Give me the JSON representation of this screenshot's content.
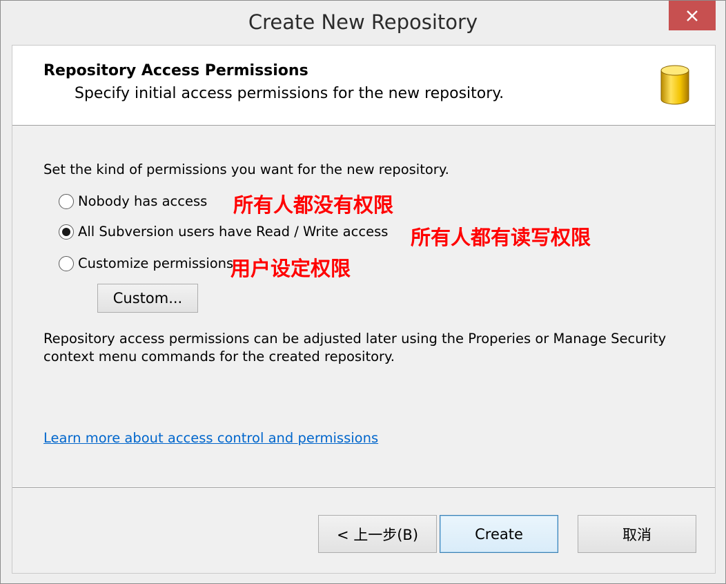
{
  "window": {
    "title": "Create New Repository",
    "close_glyph": "✕"
  },
  "header": {
    "title": "Repository Access Permissions",
    "subtitle": "Specify initial access permissions for the new repository.",
    "icon": "database-icon"
  },
  "body": {
    "intro": "Set the kind of permissions you want for the new repository.",
    "options": [
      {
        "label": "Nobody has access",
        "selected": false,
        "annotation": "所有人都没有权限"
      },
      {
        "label": "All Subversion users have Read / Write access",
        "selected": true,
        "annotation": "所有人都有读写权限"
      },
      {
        "label": "Customize permissions",
        "selected": false,
        "annotation": "用户设定权限"
      }
    ],
    "custom_button": "Custom...",
    "note_line1": "Repository access permissions can be adjusted later using the Properies or Manage Security",
    "note_line2": "context menu commands for the created repository.",
    "learn_more_link": "Learn more about access control and permissions"
  },
  "footer": {
    "back_button": "< 上一步(B)",
    "create_button": "Create",
    "cancel_button": "取消"
  },
  "colors": {
    "close_button": "#c75050",
    "annotation": "#ff0000",
    "link": "#0066cc"
  }
}
